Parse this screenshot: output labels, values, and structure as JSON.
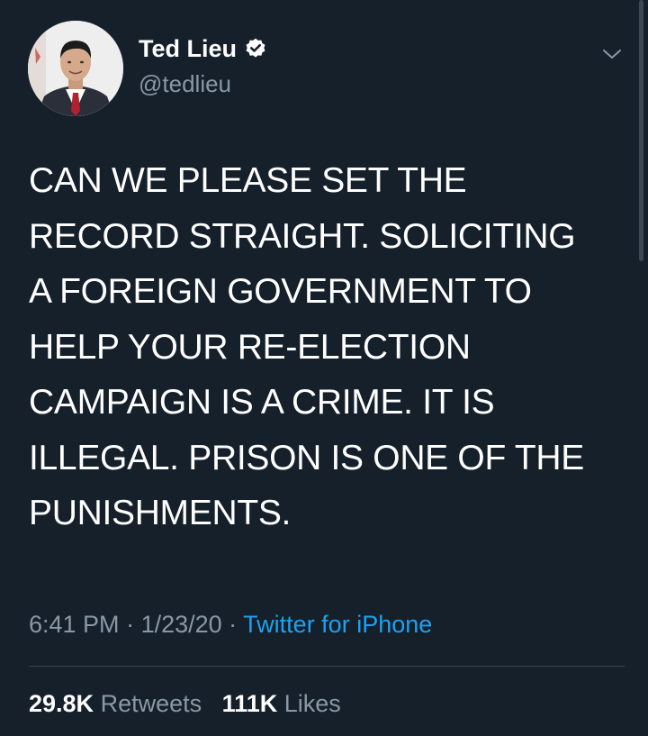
{
  "user": {
    "display_name": "Ted Lieu",
    "handle": "@tedlieu",
    "verified": true,
    "avatar_icon": "profile-photo"
  },
  "tweet": {
    "lines": [
      "CAN WE PLEASE SET THE",
      "RECORD STRAIGHT. SOLICITING",
      "A FOREIGN GOVERNMENT TO",
      "HELP YOUR RE-ELECTION",
      "CAMPAIGN IS A CRIME. IT IS",
      "ILLEGAL. PRISON IS ONE OF THE",
      "PUNISHMENTS."
    ]
  },
  "meta": {
    "time": "6:41 PM",
    "separator": " · ",
    "date": "1/23/20",
    "source": "Twitter for iPhone"
  },
  "stats": {
    "retweets_count": "29.8K",
    "retweets_label": "Retweets",
    "likes_count": "111K",
    "likes_label": "Likes"
  },
  "colors": {
    "background": "#15202b",
    "text": "#ffffff",
    "secondary": "#8899a6",
    "link": "#1da1f2"
  }
}
